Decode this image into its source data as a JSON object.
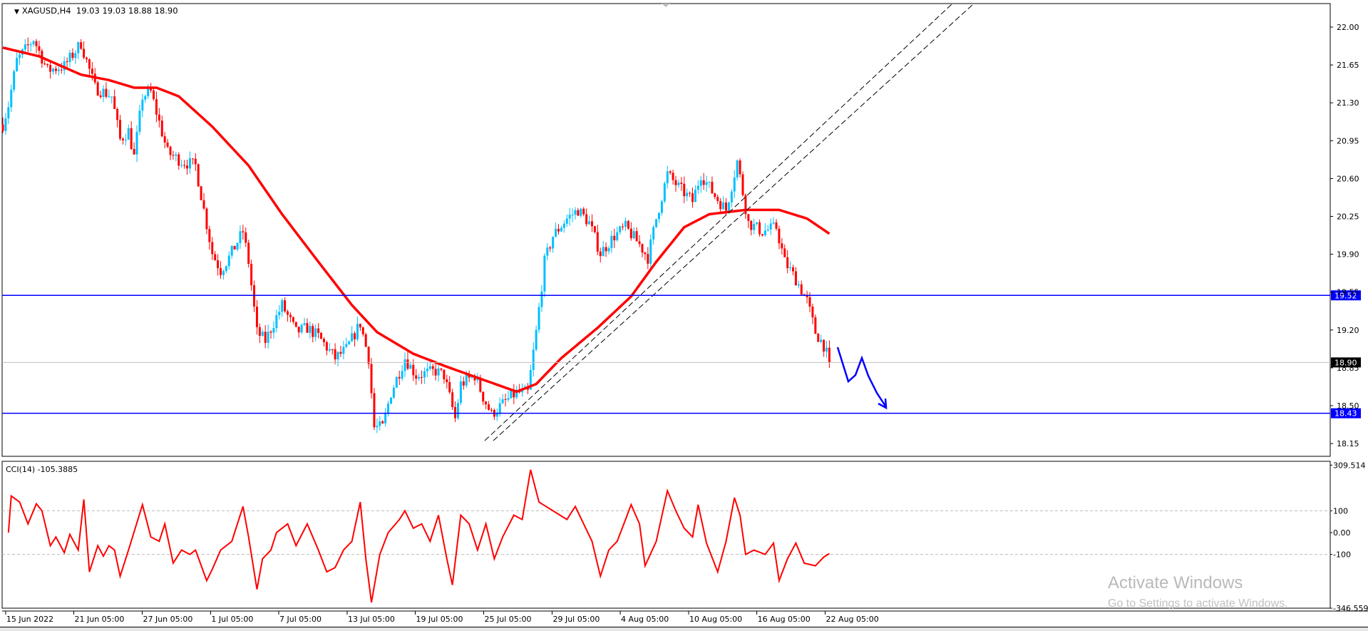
{
  "header": {
    "symbol": "XAGUSD,H4",
    "ohlc": "19.03 19.03 18.88 18.90"
  },
  "indicator": {
    "label": "CCI(14) -105.3885"
  },
  "watermark": {
    "line1": "Activate Windows",
    "line2": "Go to Settings to activate Windows."
  },
  "colors": {
    "bull": "#00bfff",
    "bear": "#ff0000",
    "ma": "#ff0000",
    "level": "#0000ff",
    "cci": "#ff0000"
  },
  "chart_data": [
    {
      "type": "candlestick",
      "title": "XAGUSD,H4",
      "x_unit": "H4 bar index",
      "ylim": [
        18.05,
        22.2
      ],
      "yticks": [
        "22.00",
        "21.65",
        "21.30",
        "20.95",
        "20.60",
        "20.25",
        "19.90",
        "19.55",
        "19.20",
        "18.85",
        "18.50",
        "18.15"
      ],
      "xticks": [
        {
          "bar": 1,
          "label": "15 Jun 2022"
        },
        {
          "bar": 25.4,
          "label": "21 Jun 05:00"
        },
        {
          "bar": 49.9,
          "label": "27 Jun 05:00"
        },
        {
          "bar": 74.4,
          "label": "1 Jul 05:00"
        },
        {
          "bar": 98.8,
          "label": "7 Jul 05:00"
        },
        {
          "bar": 123.3,
          "label": "13 Jul 05:00"
        },
        {
          "bar": 147.7,
          "label": "19 Jul 05:00"
        },
        {
          "bar": 172.2,
          "label": "25 Jul 05:00"
        },
        {
          "bar": 196.7,
          "label": "29 Jul 05:00"
        },
        {
          "bar": 221.1,
          "label": "4 Aug 05:00"
        },
        {
          "bar": 245.6,
          "label": "10 Aug 05:00"
        },
        {
          "bar": 270,
          "label": "16 Aug 05:00"
        },
        {
          "bar": 294.5,
          "label": "22 Aug 05:00"
        }
      ],
      "close_path": [
        [
          0,
          21.1
        ],
        [
          2,
          21.28
        ],
        [
          5,
          21.69
        ],
        [
          11,
          21.89
        ],
        [
          16,
          21.6
        ],
        [
          22,
          21.64
        ],
        [
          28,
          21.85
        ],
        [
          33,
          21.44
        ],
        [
          39,
          21.36
        ],
        [
          42,
          20.96
        ],
        [
          45,
          21.04
        ],
        [
          47,
          20.8
        ],
        [
          50,
          21.36
        ],
        [
          53,
          21.4
        ],
        [
          56,
          21.12
        ],
        [
          59,
          20.84
        ],
        [
          64,
          20.76
        ],
        [
          69,
          20.72
        ],
        [
          72,
          20.31
        ],
        [
          75,
          19.91
        ],
        [
          78,
          19.75
        ],
        [
          81,
          19.87
        ],
        [
          86,
          20.11
        ],
        [
          88,
          19.83
        ],
        [
          91,
          19.18
        ],
        [
          94,
          19.1
        ],
        [
          100,
          19.43
        ],
        [
          105,
          19.18
        ],
        [
          109,
          19.22
        ],
        [
          113,
          19.14
        ],
        [
          119,
          18.94
        ],
        [
          123,
          19.02
        ],
        [
          128,
          19.26
        ],
        [
          131,
          18.94
        ],
        [
          133,
          18.3
        ],
        [
          136,
          18.3
        ],
        [
          139,
          18.62
        ],
        [
          144,
          18.94
        ],
        [
          148,
          18.78
        ],
        [
          155,
          18.82
        ],
        [
          158,
          18.78
        ],
        [
          162,
          18.38
        ],
        [
          164,
          18.7
        ],
        [
          169,
          18.78
        ],
        [
          172,
          18.58
        ],
        [
          175,
          18.42
        ],
        [
          180,
          18.54
        ],
        [
          184,
          18.62
        ],
        [
          188,
          18.62
        ],
        [
          191,
          19.18
        ],
        [
          194,
          19.83
        ],
        [
          197,
          20.07
        ],
        [
          202,
          20.23
        ],
        [
          206,
          20.31
        ],
        [
          210,
          20.19
        ],
        [
          214,
          19.91
        ],
        [
          219,
          20.07
        ],
        [
          223,
          20.15
        ],
        [
          228,
          19.99
        ],
        [
          231,
          19.87
        ],
        [
          234,
          20.23
        ],
        [
          238,
          20.64
        ],
        [
          242,
          20.52
        ],
        [
          247,
          20.39
        ],
        [
          250,
          20.64
        ],
        [
          255,
          20.44
        ],
        [
          259,
          20.31
        ],
        [
          263,
          20.76
        ],
        [
          265,
          20.47
        ],
        [
          267,
          20.19
        ],
        [
          272,
          20.11
        ],
        [
          277,
          20.15
        ],
        [
          280,
          19.83
        ],
        [
          284,
          19.67
        ],
        [
          288,
          19.47
        ],
        [
          291,
          19.18
        ],
        [
          294,
          19.06
        ],
        [
          296,
          18.9
        ]
      ],
      "moving_average": [
        [
          0,
          21.81
        ],
        [
          13,
          21.73
        ],
        [
          28,
          21.56
        ],
        [
          38,
          21.51
        ],
        [
          47,
          21.44
        ],
        [
          55,
          21.44
        ],
        [
          63,
          21.36
        ],
        [
          75,
          21.08
        ],
        [
          88,
          20.72
        ],
        [
          100,
          20.27
        ],
        [
          113,
          19.83
        ],
        [
          125,
          19.43
        ],
        [
          134,
          19.18
        ],
        [
          147,
          18.98
        ],
        [
          159,
          18.86
        ],
        [
          172,
          18.74
        ],
        [
          184,
          18.63
        ],
        [
          191,
          18.7
        ],
        [
          200,
          18.94
        ],
        [
          213,
          19.22
        ],
        [
          225,
          19.51
        ],
        [
          234,
          19.83
        ],
        [
          244,
          20.15
        ],
        [
          253,
          20.27
        ],
        [
          266,
          20.31
        ],
        [
          278,
          20.31
        ],
        [
          288,
          20.23
        ],
        [
          296,
          20.09
        ]
      ],
      "levels": [
        {
          "price": 19.52,
          "label": "19.52"
        },
        {
          "price": 18.43,
          "label": "18.43"
        }
      ],
      "current_price": {
        "price": 18.9,
        "label": "18.90"
      }
    },
    {
      "type": "line",
      "title": "CCI(14)",
      "ylim": [
        -346.559,
        309.514
      ],
      "yticks": [
        "309.514",
        "100",
        "0.00",
        "-100",
        "-346.559"
      ],
      "levels": [
        100,
        -100
      ],
      "values": [
        [
          2,
          0
        ],
        [
          3,
          168
        ],
        [
          6,
          140
        ],
        [
          9,
          40
        ],
        [
          12,
          132
        ],
        [
          14,
          100
        ],
        [
          17,
          -60
        ],
        [
          19,
          -20
        ],
        [
          22,
          -92
        ],
        [
          24,
          -8
        ],
        [
          27,
          -80
        ],
        [
          29,
          152
        ],
        [
          31,
          -180
        ],
        [
          34,
          -60
        ],
        [
          36,
          -108
        ],
        [
          38,
          -60
        ],
        [
          40,
          -80
        ],
        [
          42,
          -200
        ],
        [
          45,
          -80
        ],
        [
          50,
          128
        ],
        [
          53,
          -20
        ],
        [
          56,
          -40
        ],
        [
          58,
          40
        ],
        [
          61,
          -140
        ],
        [
          64,
          -80
        ],
        [
          67,
          -100
        ],
        [
          69,
          -80
        ],
        [
          73,
          -220
        ],
        [
          75,
          -168
        ],
        [
          78,
          -80
        ],
        [
          82,
          -40
        ],
        [
          86,
          120
        ],
        [
          88,
          -20
        ],
        [
          91,
          -260
        ],
        [
          93,
          -120
        ],
        [
          96,
          -80
        ],
        [
          98,
          0
        ],
        [
          102,
          40
        ],
        [
          105,
          -60
        ],
        [
          109,
          40
        ],
        [
          113,
          -80
        ],
        [
          116,
          -180
        ],
        [
          119,
          -160
        ],
        [
          122,
          -80
        ],
        [
          125,
          -40
        ],
        [
          128,
          140
        ],
        [
          130,
          -120
        ],
        [
          132,
          -320
        ],
        [
          135,
          -100
        ],
        [
          138,
          0
        ],
        [
          142,
          60
        ],
        [
          144,
          100
        ],
        [
          147,
          20
        ],
        [
          150,
          40
        ],
        [
          153,
          -40
        ],
        [
          156,
          80
        ],
        [
          159,
          -120
        ],
        [
          161,
          -240
        ],
        [
          164,
          80
        ],
        [
          167,
          40
        ],
        [
          170,
          -80
        ],
        [
          173,
          40
        ],
        [
          176,
          -120
        ],
        [
          179,
          -20
        ],
        [
          183,
          80
        ],
        [
          186,
          60
        ],
        [
          189,
          288
        ],
        [
          192,
          140
        ],
        [
          197,
          100
        ],
        [
          202,
          60
        ],
        [
          205,
          120
        ],
        [
          208,
          40
        ],
        [
          211,
          -40
        ],
        [
          214,
          -200
        ],
        [
          217,
          -80
        ],
        [
          220,
          -40
        ],
        [
          223,
          60
        ],
        [
          225,
          128
        ],
        [
          228,
          40
        ],
        [
          230,
          -152
        ],
        [
          234,
          -40
        ],
        [
          238,
          192
        ],
        [
          241,
          100
        ],
        [
          244,
          20
        ],
        [
          247,
          -20
        ],
        [
          249,
          128
        ],
        [
          252,
          -48
        ],
        [
          256,
          -180
        ],
        [
          259,
          -40
        ],
        [
          262,
          160
        ],
        [
          264,
          80
        ],
        [
          266,
          -100
        ],
        [
          269,
          -80
        ],
        [
          273,
          -100
        ],
        [
          276,
          -48
        ],
        [
          278,
          -220
        ],
        [
          281,
          -120
        ],
        [
          284,
          -48
        ],
        [
          287,
          -140
        ],
        [
          291,
          -152
        ],
        [
          294,
          -112
        ],
        [
          296,
          -96
        ]
      ]
    }
  ]
}
